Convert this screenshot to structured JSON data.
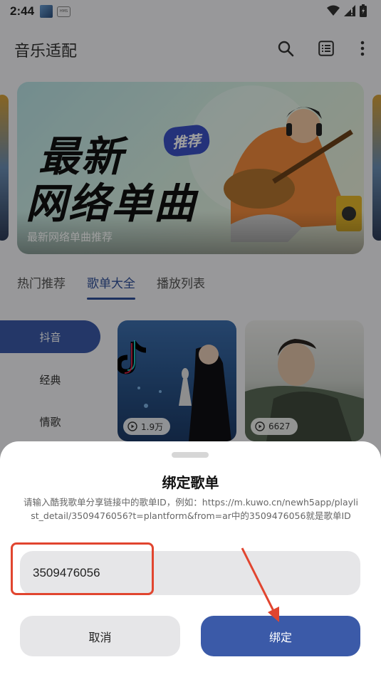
{
  "status_bar": {
    "time": "2:44",
    "badge": "HMS"
  },
  "app_bar": {
    "title": "音乐适配",
    "icons": [
      "search-icon",
      "list-icon",
      "more-vert-icon"
    ]
  },
  "banner": {
    "title_line1": "最新",
    "title_line2": "网络单曲",
    "tag": "推荐",
    "caption": "最新网络单曲推荐"
  },
  "tabs": [
    {
      "label": "热门推荐",
      "active": false
    },
    {
      "label": "歌单大全",
      "active": true
    },
    {
      "label": "播放列表",
      "active": false
    }
  ],
  "categories": [
    {
      "label": "抖音",
      "active": true
    },
    {
      "label": "经典",
      "active": false
    },
    {
      "label": "情歌",
      "active": false
    }
  ],
  "playlists": [
    {
      "play_count": "1.9万"
    },
    {
      "play_count": "6627"
    }
  ],
  "dialog": {
    "title": "绑定歌单",
    "description": "请输入酷我歌单分享链接中的歌单ID，例如：https://m.kuwo.cn/newh5app/playlist_detail/3509476056?t=plantform&from=ar中的3509476056就是歌单ID",
    "input_value": "3509476056",
    "cancel_label": "取消",
    "confirm_label": "绑定"
  },
  "colors": {
    "accent": "#3b5aa8",
    "annotation": "#e1452f"
  }
}
